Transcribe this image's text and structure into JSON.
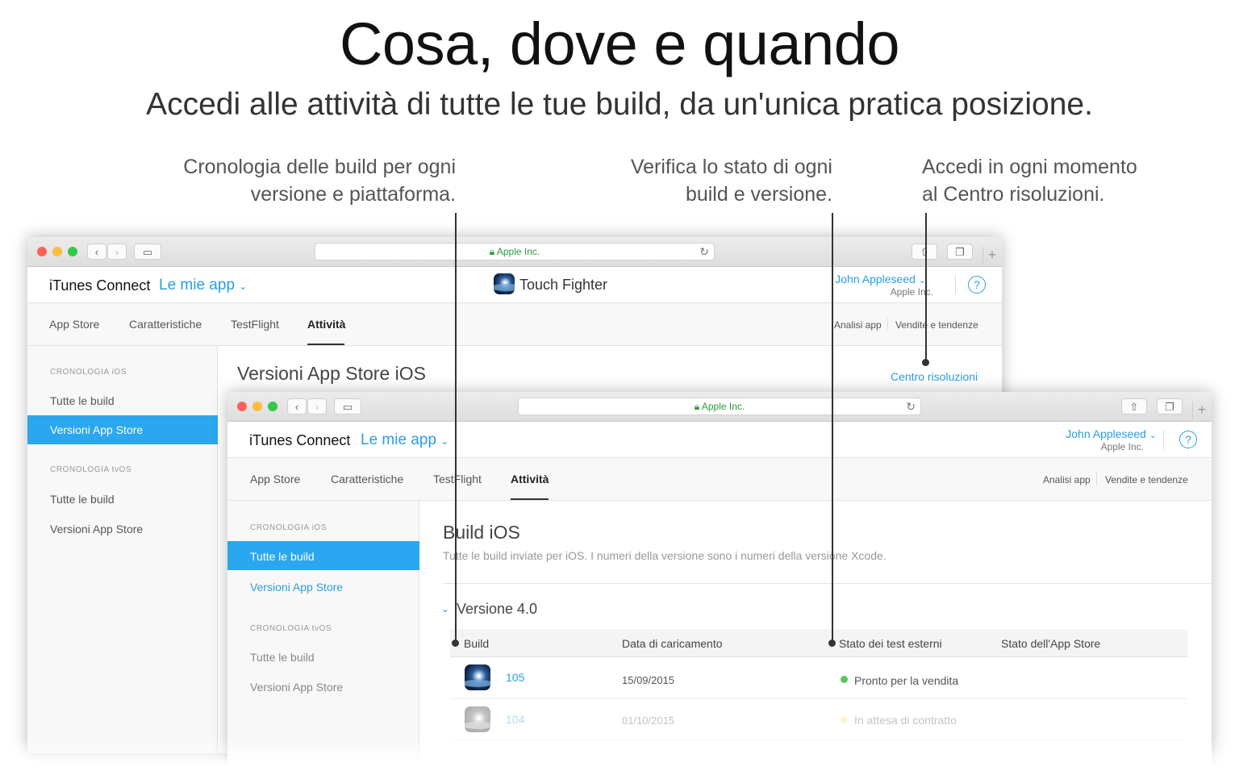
{
  "headline": "Cosa, dove e quando",
  "subheadline": "Accedi alle attività di tutte le tue build, da un'unica pratica posizione.",
  "callouts": [
    {
      "line1": "Cronologia delle build per ogni",
      "line2": "versione e piattaforma."
    },
    {
      "line1": "Verifica lo stato di ogni",
      "line2": "build e versione."
    },
    {
      "line1": "Accedi in ogni momento",
      "line2": "al Centro risoluzioni."
    }
  ],
  "colors": {
    "accent": "#2a9ee0",
    "selected": "#2aa7ee",
    "ready": "#5cc35c",
    "waiting": "#f1e07a"
  },
  "browser": {
    "url": "Apple Inc.",
    "lock_icon": "lock-icon",
    "reload_icon": "reload-icon"
  },
  "header": {
    "brand": "iTunes Connect",
    "my_apps": "Le mie app",
    "app_name": "Touch Fighter",
    "user_name": "John Appleseed",
    "user_org": "Apple Inc.",
    "help": "?"
  },
  "tabs": [
    "App Store",
    "Caratteristiche",
    "TestFlight",
    "Attività"
  ],
  "right_tabs": [
    "Analisi app",
    "Vendite e tendenze"
  ],
  "back_window": {
    "sidebar": {
      "section_ios": "CRONOLOGIA iOS",
      "all_builds": "Tutte le build",
      "app_store_versions": "Versioni App Store",
      "section_tvos": "CRONOLOGIA tvOS",
      "tv_all_builds": "Tutte le build",
      "tv_app_store_versions": "Versioni App Store"
    },
    "title": "Versioni App Store iOS",
    "resolution_center": "Centro risoluzioni"
  },
  "front_window": {
    "sidebar": {
      "section_ios": "CRONOLOGIA iOS",
      "all_builds": "Tutte le build",
      "app_store_versions": "Versioni App Store",
      "section_tvos": "CRONOLOGIA tvOS",
      "tv_all_builds": "Tutte le build",
      "tv_app_store_versions": "Versioni App Store"
    },
    "title": "Build iOS",
    "description": "Tutte le build inviate per iOS. I numeri della versione sono i numeri della versione Xcode.",
    "version": "Versione 4.0",
    "columns": [
      "Build",
      "Data di caricamento",
      "Stato dei test esterni",
      "Stato dell'App Store"
    ],
    "rows": [
      {
        "build": "105",
        "date": "15/09/2015",
        "status": "Pronto per la vendita",
        "store": ""
      },
      {
        "build": "104",
        "date": "01/10/2015",
        "status": "In attesa di contratto",
        "store": ""
      }
    ]
  }
}
